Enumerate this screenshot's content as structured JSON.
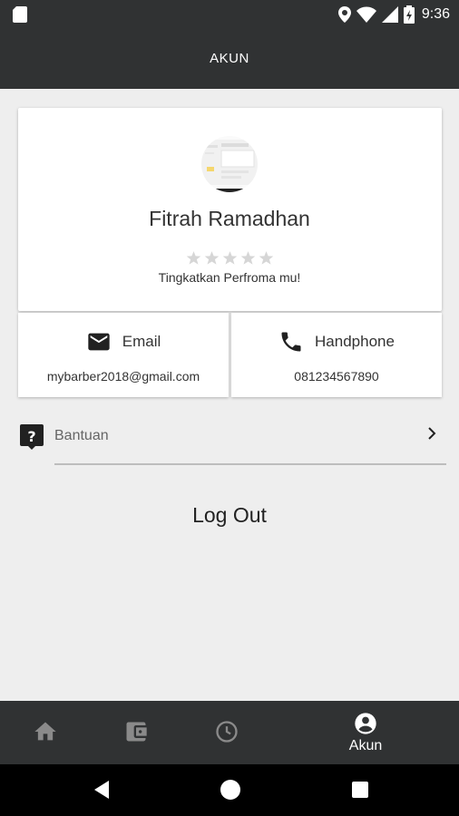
{
  "status_bar": {
    "time": "9:36",
    "icons": [
      "sd-card-icon",
      "location-icon",
      "wifi-icon",
      "signal-icon",
      "battery-icon"
    ]
  },
  "app_bar": {
    "title": "AKUN"
  },
  "profile": {
    "name": "Fitrah Ramadhan",
    "rating": 0,
    "rating_max": 5,
    "tagline": "Tingkatkan Perfroma mu!"
  },
  "contact": {
    "email": {
      "label": "Email",
      "value": "mybarber2018@gmail.com",
      "icon": "mail-icon"
    },
    "phone": {
      "label": "Handphone",
      "value": "081234567890",
      "icon": "phone-icon"
    }
  },
  "help": {
    "label": "Bantuan",
    "icon": "help-icon"
  },
  "logout": {
    "label": "Log Out"
  },
  "bottom_nav": {
    "items": [
      {
        "icon": "home-icon",
        "label": ""
      },
      {
        "icon": "wallet-icon",
        "label": ""
      },
      {
        "icon": "history-icon",
        "label": ""
      },
      {
        "icon": "account-icon",
        "label": "Akun",
        "active": true
      }
    ]
  },
  "colors": {
    "bar": "#303233",
    "background": "#eeeeee",
    "card": "#ffffff",
    "inactive_icon": "#8a8a8a"
  }
}
